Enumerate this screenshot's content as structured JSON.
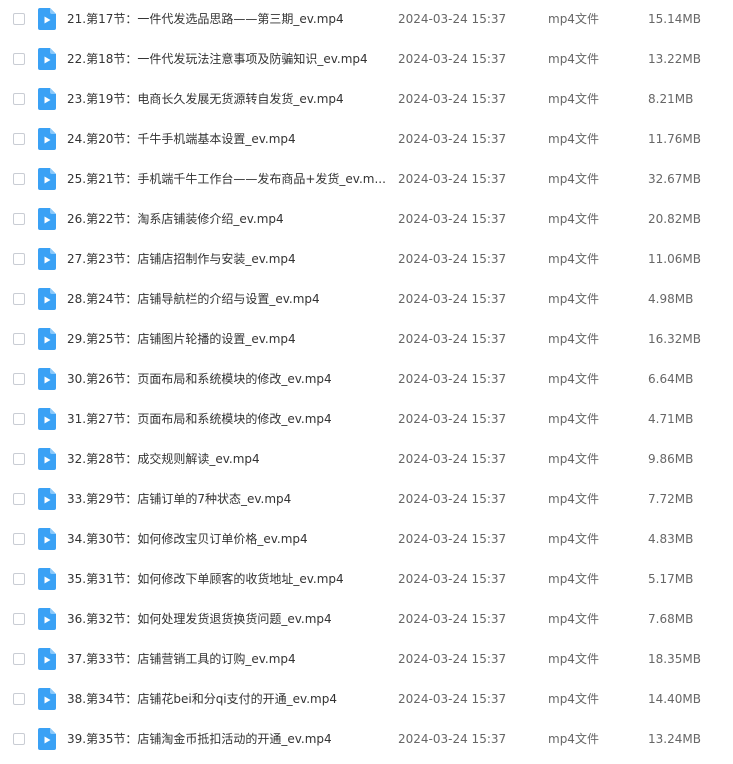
{
  "file_type_label": "mp4文件",
  "icon": "video-file-icon",
  "accent_color": "#3aa1f5",
  "files": [
    {
      "name": "21.第17节：一件代发选品思路——第三期_ev.mp4",
      "date": "2024-03-24 15:37",
      "type": "mp4文件",
      "size": "15.14MB"
    },
    {
      "name": "22.第18节：一件代发玩法注意事项及防骗知识_ev.mp4",
      "date": "2024-03-24 15:37",
      "type": "mp4文件",
      "size": "13.22MB"
    },
    {
      "name": "23.第19节：电商长久发展无货源转自发货_ev.mp4",
      "date": "2024-03-24 15:37",
      "type": "mp4文件",
      "size": "8.21MB"
    },
    {
      "name": "24.第20节：千牛手机端基本设置_ev.mp4",
      "date": "2024-03-24 15:37",
      "type": "mp4文件",
      "size": "11.76MB"
    },
    {
      "name": "25.第21节：手机端千牛工作台——发布商品+发货_ev.m...",
      "date": "2024-03-24 15:37",
      "type": "mp4文件",
      "size": "32.67MB"
    },
    {
      "name": "26.第22节：淘系店铺装修介绍_ev.mp4",
      "date": "2024-03-24 15:37",
      "type": "mp4文件",
      "size": "20.82MB"
    },
    {
      "name": "27.第23节：店铺店招制作与安装_ev.mp4",
      "date": "2024-03-24 15:37",
      "type": "mp4文件",
      "size": "11.06MB"
    },
    {
      "name": "28.第24节：店铺导航栏的介绍与设置_ev.mp4",
      "date": "2024-03-24 15:37",
      "type": "mp4文件",
      "size": "4.98MB"
    },
    {
      "name": "29.第25节：店铺图片轮播的设置_ev.mp4",
      "date": "2024-03-24 15:37",
      "type": "mp4文件",
      "size": "16.32MB"
    },
    {
      "name": "30.第26节：页面布局和系统模块的修改_ev.mp4",
      "date": "2024-03-24 15:37",
      "type": "mp4文件",
      "size": "6.64MB"
    },
    {
      "name": "31.第27节：页面布局和系统模块的修改_ev.mp4",
      "date": "2024-03-24 15:37",
      "type": "mp4文件",
      "size": "4.71MB"
    },
    {
      "name": "32.第28节：成交规则解读_ev.mp4",
      "date": "2024-03-24 15:37",
      "type": "mp4文件",
      "size": "9.86MB"
    },
    {
      "name": "33.第29节：店铺订单的7种状态_ev.mp4",
      "date": "2024-03-24 15:37",
      "type": "mp4文件",
      "size": "7.72MB"
    },
    {
      "name": "34.第30节：如何修改宝贝订单价格_ev.mp4",
      "date": "2024-03-24 15:37",
      "type": "mp4文件",
      "size": "4.83MB"
    },
    {
      "name": "35.第31节：如何修改下单顾客的收货地址_ev.mp4",
      "date": "2024-03-24 15:37",
      "type": "mp4文件",
      "size": "5.17MB"
    },
    {
      "name": "36.第32节：如何处理发货退货换货问题_ev.mp4",
      "date": "2024-03-24 15:37",
      "type": "mp4文件",
      "size": "7.68MB"
    },
    {
      "name": "37.第33节：店铺营销工具的订购_ev.mp4",
      "date": "2024-03-24 15:37",
      "type": "mp4文件",
      "size": "18.35MB"
    },
    {
      "name": "38.第34节：店铺花bei和分qi支付的开通_ev.mp4",
      "date": "2024-03-24 15:37",
      "type": "mp4文件",
      "size": "14.40MB"
    },
    {
      "name": "39.第35节：店铺淘金币抵扣活动的开通_ev.mp4",
      "date": "2024-03-24 15:37",
      "type": "mp4文件",
      "size": "13.24MB"
    }
  ]
}
